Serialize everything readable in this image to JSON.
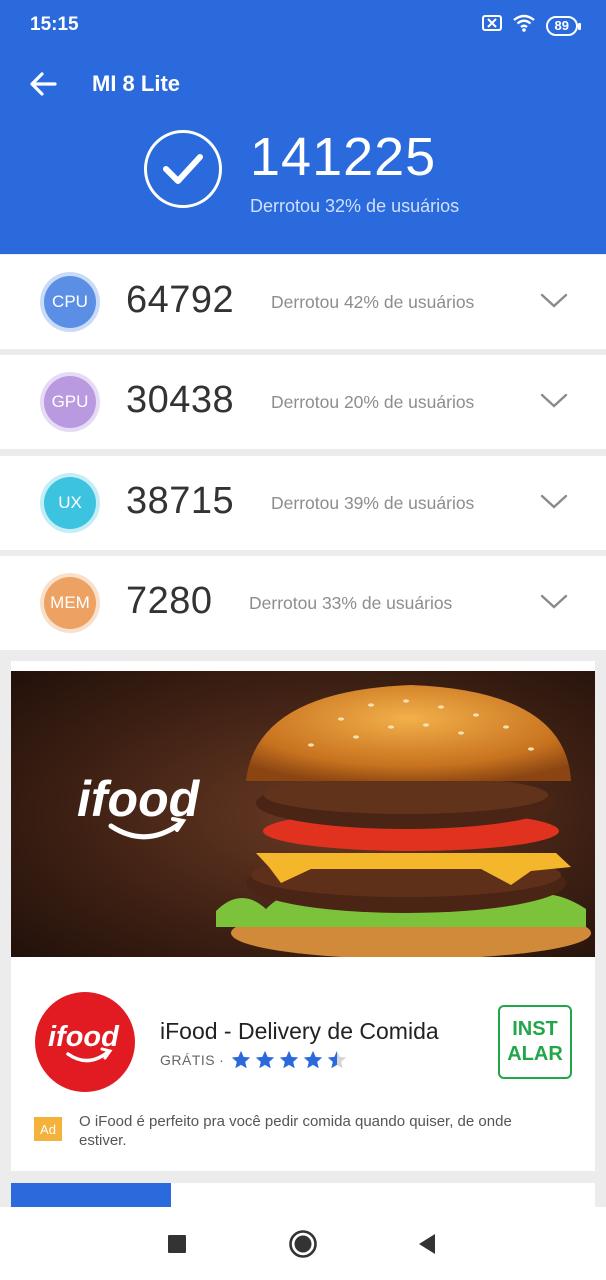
{
  "status_bar": {
    "time": "15:15",
    "battery": "89",
    "icons": [
      "sim-x-icon",
      "wifi-icon",
      "battery-icon"
    ]
  },
  "app_bar": {
    "title": "MI 8 Lite",
    "back_icon": "arrow-left-icon"
  },
  "summary": {
    "total_score": "141225",
    "defeat_text": "Derrotou 32% de usuários",
    "icon": "check-circle-icon"
  },
  "scores": [
    {
      "label": "CPU",
      "score": "64792",
      "defeat_text": "Derrotou 42% de usuários",
      "color": "#5b8fe6",
      "ring": "#c9dbf7"
    },
    {
      "label": "GPU",
      "score": "30438",
      "defeat_text": "Derrotou 20% de usuários",
      "color": "#b99ae0",
      "ring": "#e6dbf5"
    },
    {
      "label": "UX",
      "score": "38715",
      "defeat_text": "Derrotou 39% de usuários",
      "color": "#3cc3e0",
      "ring": "#c4edf6"
    },
    {
      "label": "MEM",
      "score": "7280",
      "defeat_text": "Derrotou 33% de usuários",
      "color": "#eda264",
      "ring": "#f8e0cb"
    }
  ],
  "ad": {
    "banner_brand": "ifood",
    "logo_text": "ifood",
    "app_name": "iFood - Delivery de Comida",
    "price": "GRÁTIS",
    "separator": "·",
    "rating": 4.5,
    "install_label_1": "INST",
    "install_label_2": "ALAR",
    "ad_badge": "Ad",
    "description": "O iFood é perfeito pra você pedir comida quando quiser, de onde estiver."
  },
  "colors": {
    "header": "#2a6add",
    "install": "#22a64a",
    "star": "#2a6add"
  }
}
